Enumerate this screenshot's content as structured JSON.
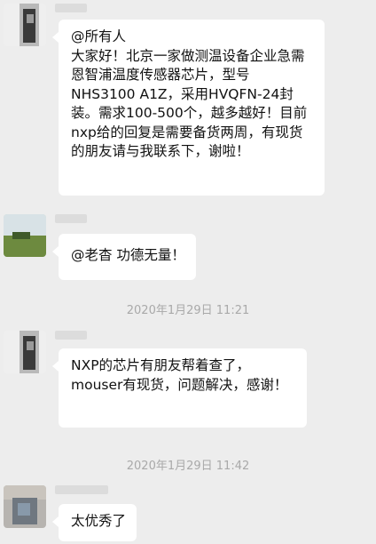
{
  "colors": {
    "background": "#ededed",
    "bubble": "#ffffff",
    "text": "#111111",
    "timestamp": "#a9a9a9"
  },
  "messages": [
    {
      "avatar_icon": "blurred-avatar-icon",
      "text": "@所有人\n大家好！北京一家做测温设备企业急需恩智浦温度传感器芯片，型号NHS3100 A1Z，采用HVQFN-24封装。需求100-500个，越多越好！目前nxp给的回复是需要备货两周，有现货的朋友请与我联系下，谢啦！"
    },
    {
      "avatar_icon": "landscape-avatar-icon",
      "text": "@老杳 功德无量！"
    },
    {
      "timestamp": "2020年1月29日 11:21"
    },
    {
      "avatar_icon": "blurred-avatar-icon",
      "text": "NXP的芯片有朋友帮着查了，mouser有现货，问题解决，感谢！"
    },
    {
      "timestamp": "2020年1月29日 11:42"
    },
    {
      "avatar_icon": "blurred-avatar-icon",
      "text": "太优秀了"
    }
  ]
}
